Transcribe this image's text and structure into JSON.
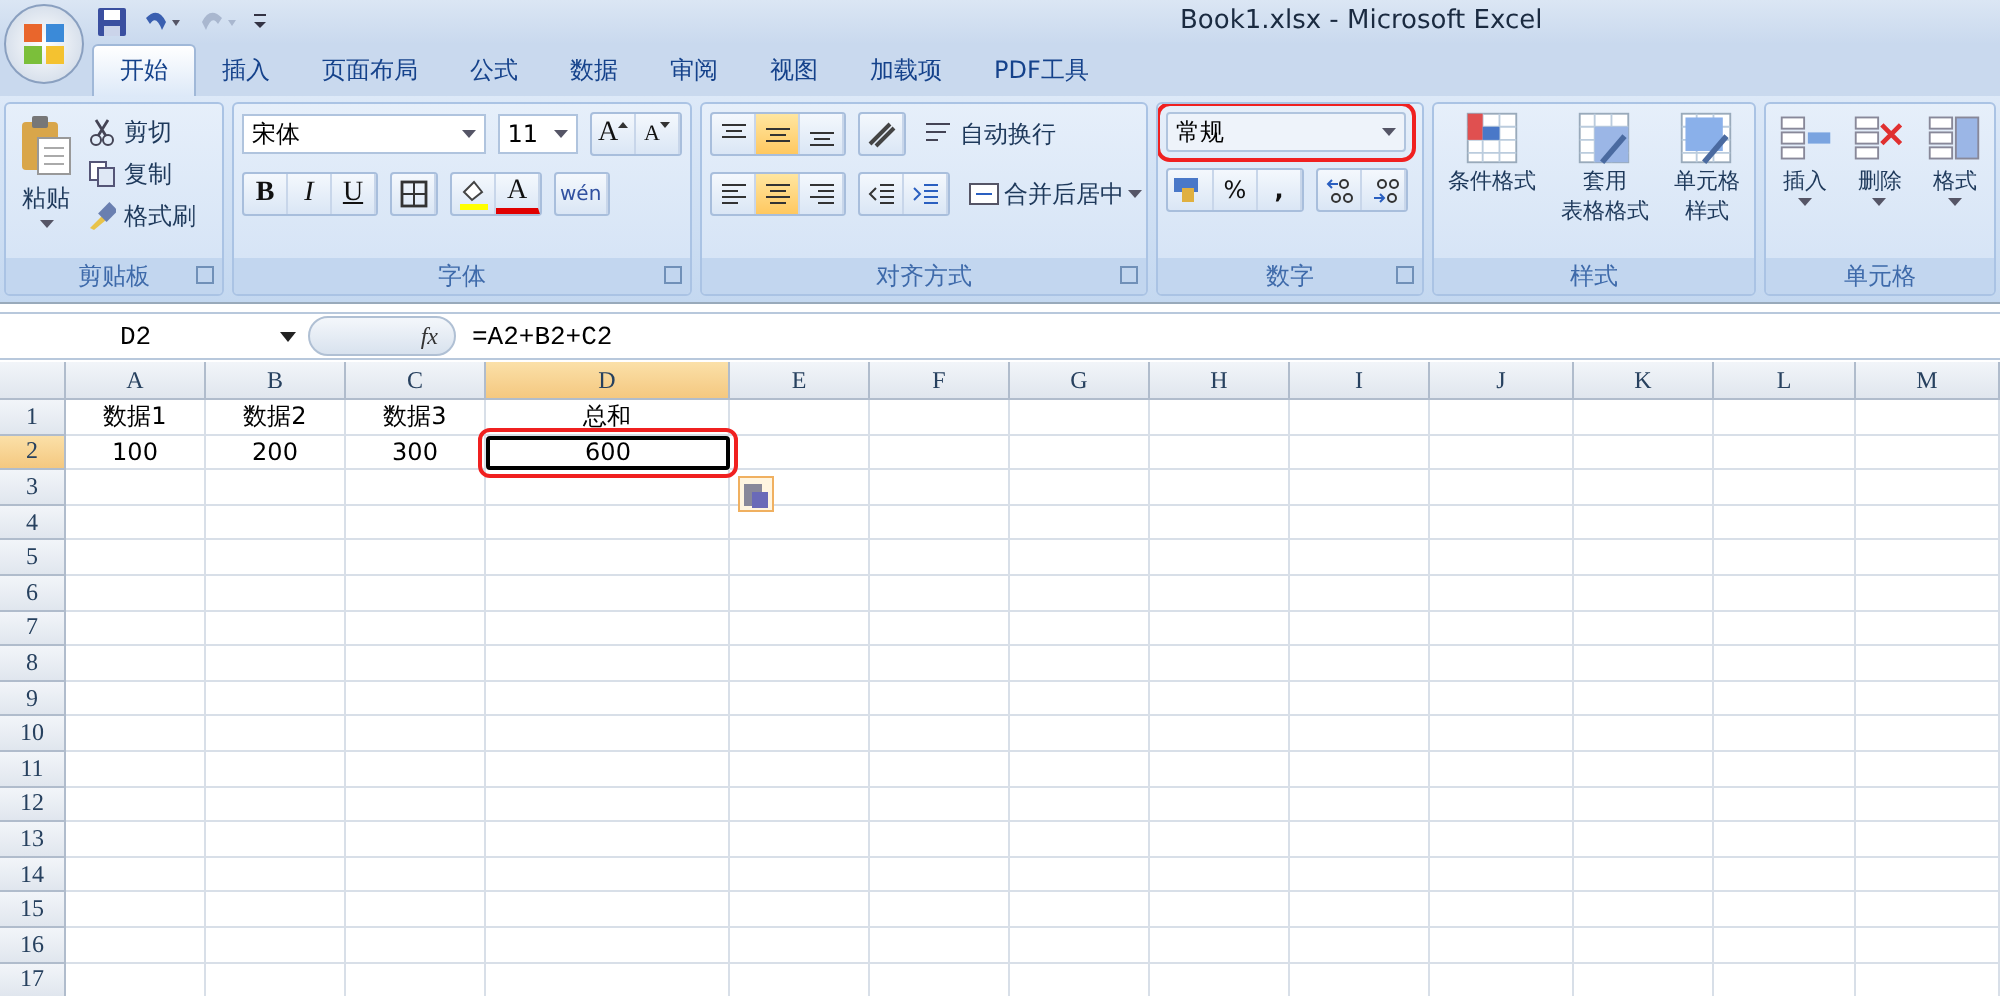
{
  "window": {
    "title": "Book1.xlsx - Microsoft Excel"
  },
  "tabs": [
    {
      "label": "开始",
      "selected": true
    },
    {
      "label": "插入",
      "selected": false
    },
    {
      "label": "页面布局",
      "selected": false
    },
    {
      "label": "公式",
      "selected": false
    },
    {
      "label": "数据",
      "selected": false
    },
    {
      "label": "审阅",
      "selected": false
    },
    {
      "label": "视图",
      "selected": false
    },
    {
      "label": "加载项",
      "selected": false
    },
    {
      "label": "PDF工具",
      "selected": false
    }
  ],
  "clipboard": {
    "label": "剪贴板",
    "paste": "粘贴",
    "cut": "剪切",
    "copy": "复制",
    "format_painter": "格式刷"
  },
  "font": {
    "label": "字体",
    "name": "宋体",
    "size": "11",
    "grow": "A",
    "shrink": "A",
    "bold": "B",
    "italic": "I",
    "underline": "U",
    "font_color": "A",
    "phonetic": "wén"
  },
  "alignment": {
    "label": "对齐方式",
    "vertical": [
      {
        "selected": false
      },
      {
        "selected": true
      },
      {
        "selected": false
      }
    ],
    "horizontal": [
      {
        "selected": false
      },
      {
        "selected": true
      },
      {
        "selected": false
      }
    ],
    "wrap": "自动换行",
    "merge": "合并后居中"
  },
  "number": {
    "label": "数字",
    "format": "常规",
    "annotated": true,
    "percent": "%",
    "comma": ","
  },
  "styles": {
    "label": "样式",
    "items": [
      {
        "lines": [
          "条件格式"
        ]
      },
      {
        "lines": [
          "套用",
          "表格格式"
        ]
      },
      {
        "lines": [
          "单元格",
          "样式"
        ]
      }
    ]
  },
  "cells_group": {
    "label": "单元格",
    "items": [
      "插入",
      "删除",
      "格式"
    ]
  },
  "formula_bar": {
    "name_box": "D2",
    "function_button": "fx",
    "formula": "=A2+B2+C2"
  },
  "sheet": {
    "columns": [
      {
        "label": "A",
        "selected": false
      },
      {
        "label": "B",
        "selected": false
      },
      {
        "label": "C",
        "selected": false
      },
      {
        "label": "D",
        "selected": true
      },
      {
        "label": "E",
        "selected": false
      },
      {
        "label": "F",
        "selected": false
      },
      {
        "label": "G",
        "selected": false
      },
      {
        "label": "H",
        "selected": false
      },
      {
        "label": "I",
        "selected": false
      },
      {
        "label": "J",
        "selected": false
      },
      {
        "label": "K",
        "selected": false
      },
      {
        "label": "L",
        "selected": false
      },
      {
        "label": "M",
        "selected": false
      }
    ],
    "rows": [
      {
        "label": "1",
        "selected": false,
        "cells": [
          {
            "text": "数据1",
            "selected": false,
            "annotated": false
          },
          {
            "text": "数据2",
            "selected": false,
            "annotated": false
          },
          {
            "text": "数据3",
            "selected": false,
            "annotated": false
          },
          {
            "text": "总和",
            "selected": false,
            "annotated": false
          }
        ]
      },
      {
        "label": "2",
        "selected": true,
        "cells": [
          {
            "text": "100",
            "selected": false,
            "annotated": false
          },
          {
            "text": "200",
            "selected": false,
            "annotated": false
          },
          {
            "text": "300",
            "selected": false,
            "annotated": false
          },
          {
            "text": "600",
            "selected": true,
            "annotated": true
          }
        ]
      },
      {
        "label": "3",
        "selected": false
      },
      {
        "label": "4",
        "selected": false
      },
      {
        "label": "5",
        "selected": false
      },
      {
        "label": "6",
        "selected": false
      },
      {
        "label": "7",
        "selected": false
      },
      {
        "label": "8",
        "selected": false
      },
      {
        "label": "9",
        "selected": false
      },
      {
        "label": "10",
        "selected": false
      },
      {
        "label": "11",
        "selected": false
      },
      {
        "label": "12",
        "selected": false
      },
      {
        "label": "13",
        "selected": false
      },
      {
        "label": "14",
        "selected": false
      },
      {
        "label": "15",
        "selected": false
      },
      {
        "label": "16",
        "selected": false
      },
      {
        "label": "17",
        "selected": false
      }
    ]
  }
}
